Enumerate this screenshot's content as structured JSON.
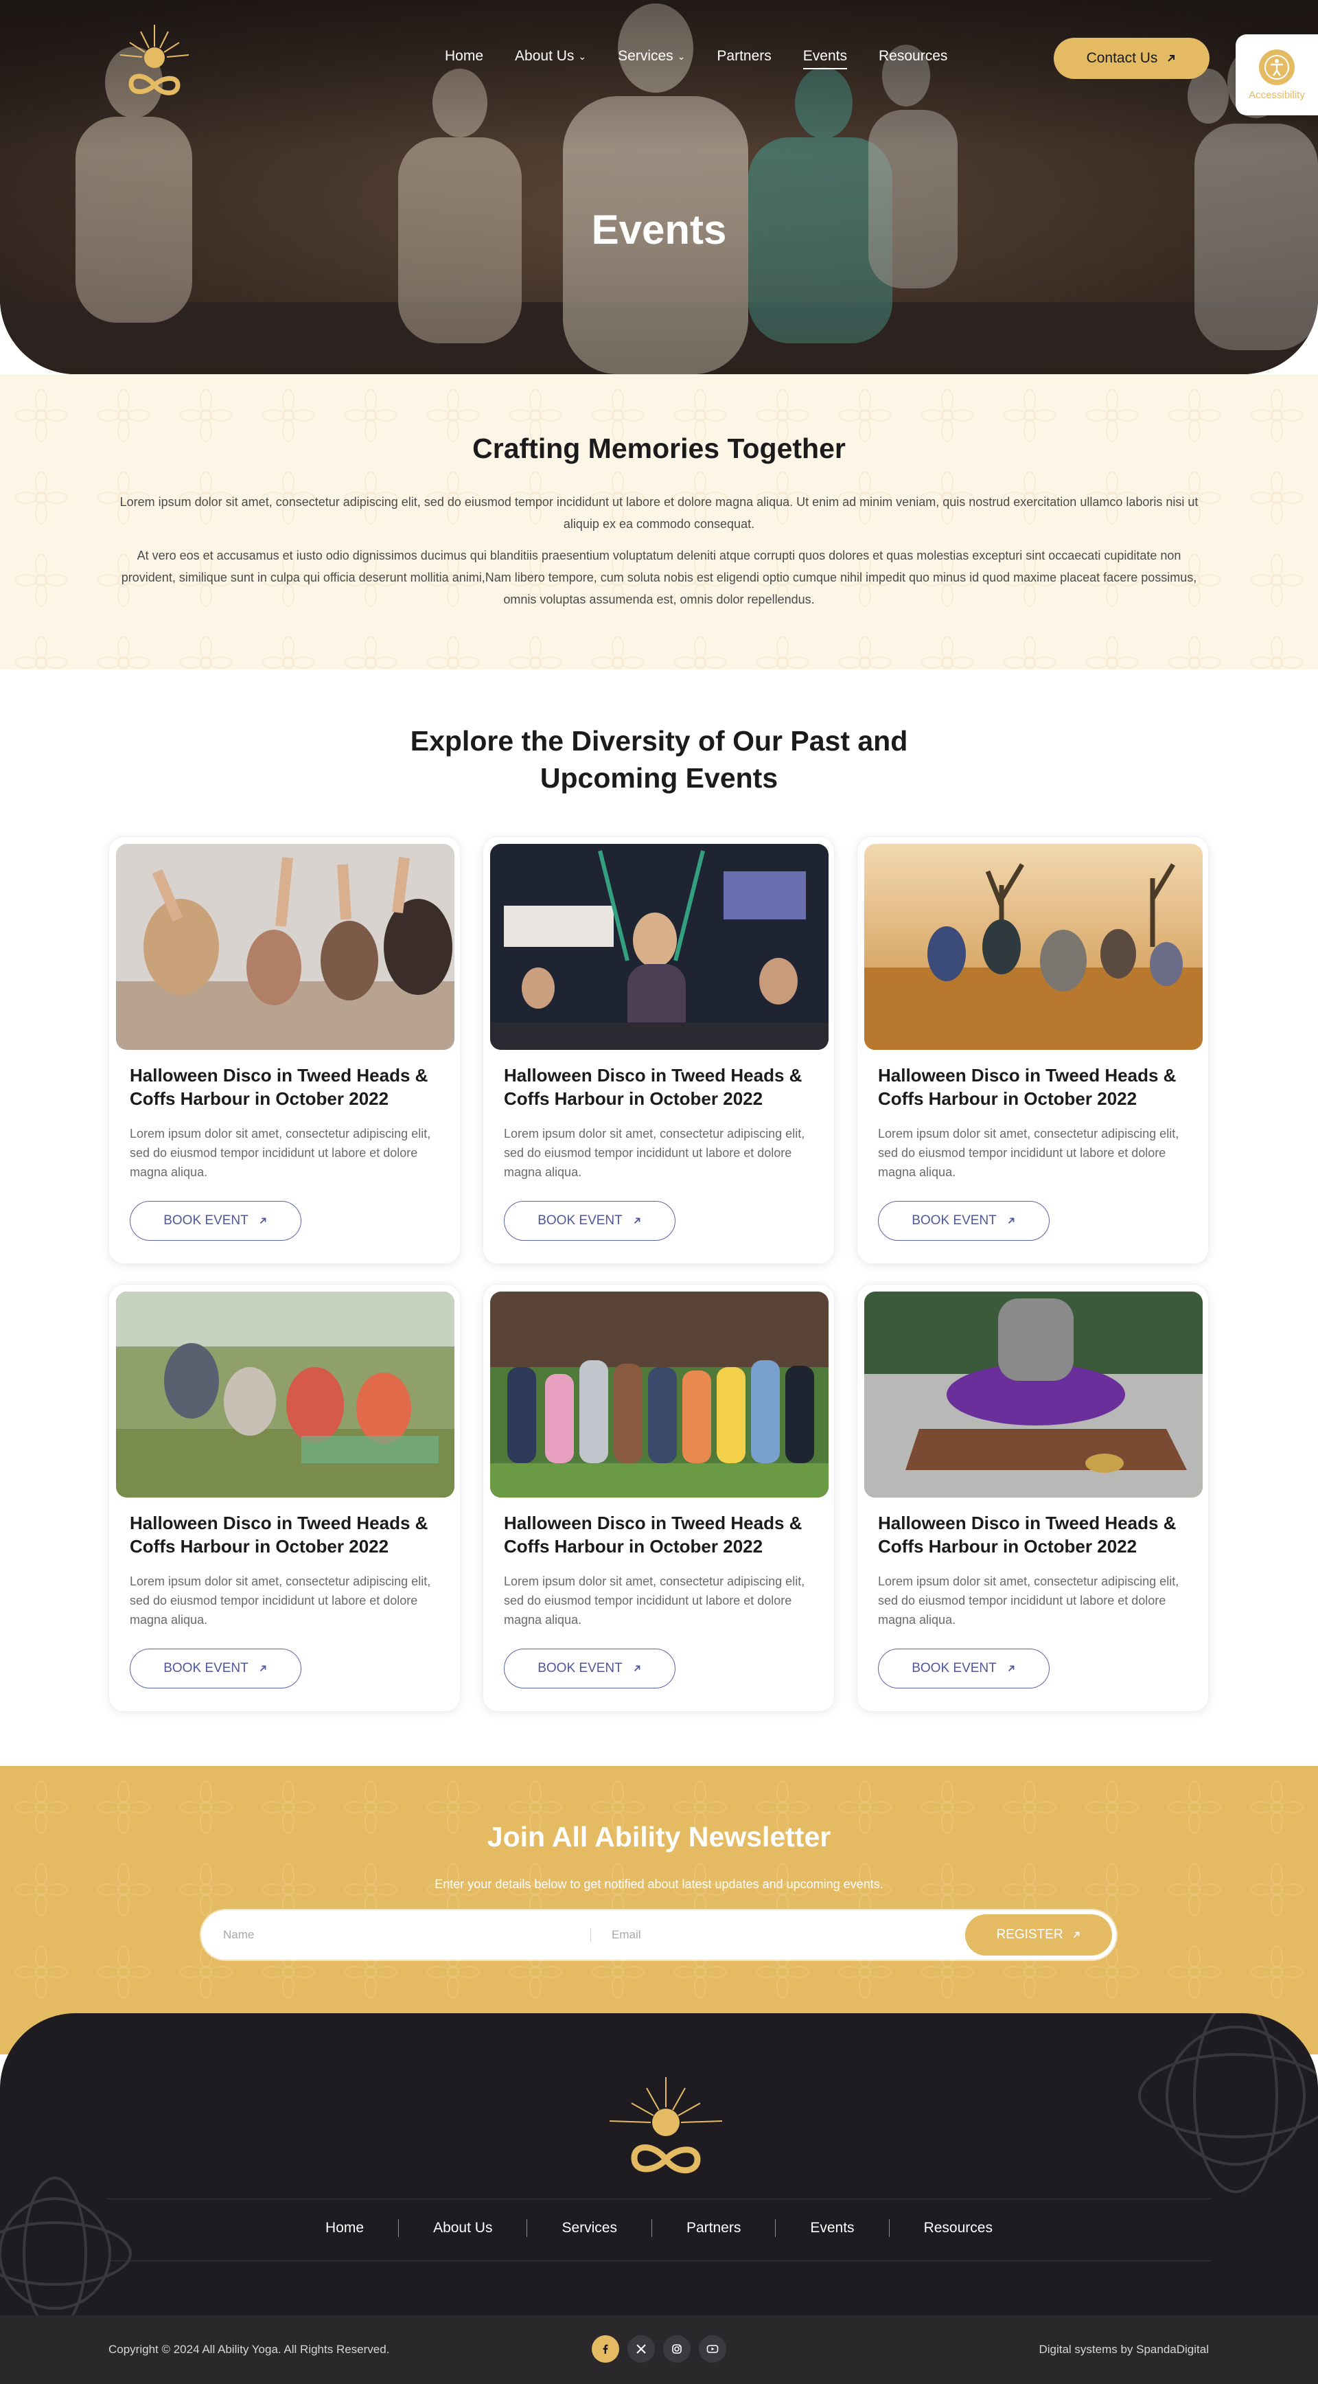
{
  "header": {
    "logo_alt": "All Ability Yoga",
    "nav": [
      {
        "label": "Home",
        "dropdown": false,
        "active": false
      },
      {
        "label": "About Us",
        "dropdown": true,
        "active": false
      },
      {
        "label": "Services",
        "dropdown": true,
        "active": false
      },
      {
        "label": "Partners",
        "dropdown": false,
        "active": false
      },
      {
        "label": "Events",
        "dropdown": false,
        "active": true
      },
      {
        "label": "Resources",
        "dropdown": false,
        "active": false
      }
    ],
    "contact_label": "Contact Us",
    "accessibility_label": "Accessibility"
  },
  "hero": {
    "title": "Events"
  },
  "intro": {
    "title": "Crafting Memories Together",
    "paragraph1": "Lorem ipsum dolor sit amet, consectetur adipiscing elit, sed do eiusmod tempor incididunt ut labore et dolore magna aliqua. Ut enim ad minim veniam, quis nostrud exercitation ullamco laboris nisi ut aliquip ex ea commodo consequat.",
    "paragraph2": "At vero eos et accusamus et iusto odio dignissimos ducimus qui blanditiis praesentium voluptatum deleniti atque corrupti quos dolores et quas molestias excepturi sint occaecati cupiditate non provident, similique sunt in culpa qui officia deserunt mollitia animi,Nam libero tempore, cum soluta nobis est eligendi optio cumque nihil impedit quo minus id quod maxime placeat facere possimus, omnis voluptas assumenda est, omnis dolor repellendus."
  },
  "events": {
    "title_line1": "Explore the Diversity of Our Past and",
    "title_line2": "Upcoming Events",
    "cards": [
      {
        "title": "Halloween Disco in Tweed Heads & Coffs Harbour in October 2022",
        "description": "Lorem ipsum dolor sit amet, consectetur adipiscing elit, sed do eiusmod tempor incididunt ut labore et dolore magna aliqua.",
        "button": "BOOK EVENT",
        "image": "group-celebrating-photo"
      },
      {
        "title": "Halloween Disco in Tweed Heads & Coffs Harbour in October 2022",
        "description": "Lorem ipsum dolor sit amet, consectetur adipiscing elit, sed do eiusmod tempor incididunt ut labore et dolore magna aliqua.",
        "button": "BOOK EVENT",
        "image": "fitness-class-photo"
      },
      {
        "title": "Halloween Disco in Tweed Heads & Coffs Harbour in October 2022",
        "description": "Lorem ipsum dolor sit amet, consectetur adipiscing elit, sed do eiusmod tempor incididunt ut labore et dolore magna aliqua.",
        "button": "BOOK EVENT",
        "image": "desert-running-photo"
      },
      {
        "title": "Halloween Disco in Tweed Heads & Coffs Harbour in October 2022",
        "description": "Lorem ipsum dolor sit amet, consectetur adipiscing elit, sed do eiusmod tempor incididunt ut labore et dolore magna aliqua.",
        "button": "BOOK EVENT",
        "image": "seniors-picnic-photo"
      },
      {
        "title": "Halloween Disco in Tweed Heads & Coffs Harbour in October 2022",
        "description": "Lorem ipsum dolor sit amet, consectetur adipiscing elit, sed do eiusmod tempor incididunt ut labore et dolore magna aliqua.",
        "button": "BOOK EVENT",
        "image": "group-portrait-photo"
      },
      {
        "title": "Halloween Disco in Tweed Heads & Coffs Harbour in October 2022",
        "description": "Lorem ipsum dolor sit amet, consectetur adipiscing elit, sed do eiusmod tempor incididunt ut labore et dolore magna aliqua.",
        "button": "BOOK EVENT",
        "image": "meditation-cushion-photo"
      }
    ]
  },
  "newsletter": {
    "title": "Join All Ability Newsletter",
    "subtitle": "Enter your details below to get notified about latest updates and upcoming events.",
    "name_placeholder": "Name",
    "email_placeholder": "Email",
    "button": "REGISTER"
  },
  "footer": {
    "nav": [
      "Home",
      "About Us",
      "Services",
      "Partners",
      "Events",
      "Resources"
    ],
    "copyright": "Copyright © 2024 All Ability Yoga. All Rights Reserved.",
    "credit": "Digital systems by SpandaDigital",
    "socials": [
      "facebook-icon",
      "x-icon",
      "instagram-icon",
      "youtube-icon"
    ]
  },
  "colors": {
    "gold": "#e4ba63",
    "cream": "#fdf5e6",
    "dark": "#1e1c20",
    "button_outline": "#5b64a8"
  }
}
